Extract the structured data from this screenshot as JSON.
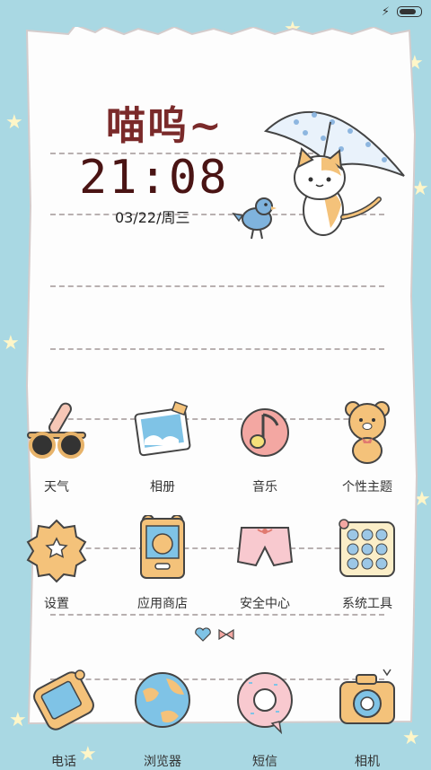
{
  "status": {
    "battery_level": 1.0
  },
  "widget": {
    "greeting": "喵呜~",
    "time": "21:08",
    "date": "03/22/周三"
  },
  "apps": [
    {
      "label": "天气",
      "icon": "sunglasses-thermometer-icon"
    },
    {
      "label": "相册",
      "icon": "photo-frame-icon"
    },
    {
      "label": "音乐",
      "icon": "music-note-icon"
    },
    {
      "label": "个性主题",
      "icon": "teddy-bear-icon"
    },
    {
      "label": "设置",
      "icon": "gear-icon"
    },
    {
      "label": "应用商店",
      "icon": "bear-store-icon"
    },
    {
      "label": "安全中心",
      "icon": "shorts-icon"
    },
    {
      "label": "系统工具",
      "icon": "toolbox-icon"
    }
  ],
  "dock": [
    {
      "label": "电话",
      "icon": "phone-icon"
    },
    {
      "label": "浏览器",
      "icon": "globe-icon"
    },
    {
      "label": "短信",
      "icon": "donut-message-icon"
    },
    {
      "label": "相机",
      "icon": "camera-icon"
    }
  ],
  "colors": {
    "background": "#a9d8e3",
    "paper": "#fdfdfd",
    "title": "#7a2a2a",
    "time": "#4a1414"
  }
}
